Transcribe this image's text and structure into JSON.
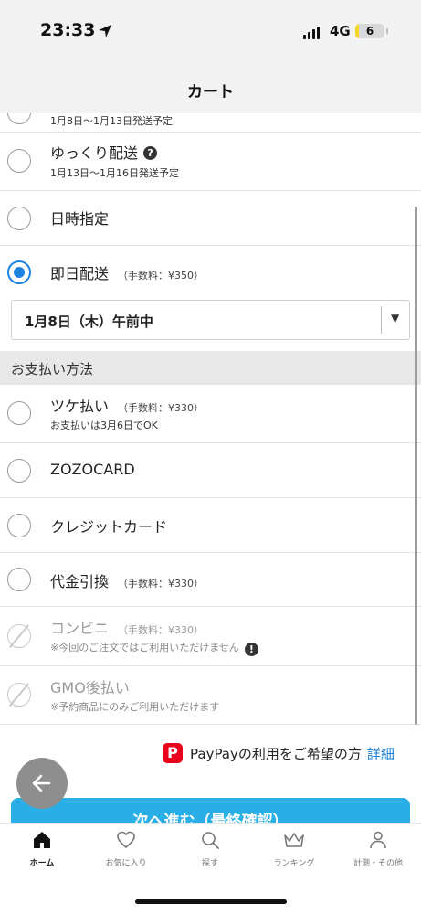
{
  "status_bar": {
    "time": "23:33",
    "network": "4G",
    "battery": "6",
    "battery_fraction": 0.06
  },
  "header": {
    "title": "カート"
  },
  "delivery_options": [
    {
      "title": "",
      "sub": "1月8日〜1月13日発送予定",
      "state": "default"
    },
    {
      "title": "ゆっくり配送",
      "sub": "1月13日〜1月16日発送予定",
      "state": "default",
      "help_icon": "?"
    },
    {
      "title": "日時指定",
      "state": "default"
    },
    {
      "title": "即日配送",
      "fee": "（手数料：¥350）",
      "state": "selected"
    }
  ],
  "date_select": {
    "value": "1月8日（木）午前中",
    "arrow": "▼"
  },
  "payment": {
    "section_title": "お支払い方法",
    "options": [
      {
        "title": "ツケ払い",
        "fee": "（手数料：¥330）",
        "sub": "お支払いは3月6日でOK",
        "state": "default"
      },
      {
        "title": "ZOZOCARD",
        "state": "default"
      },
      {
        "title": "クレジットカード",
        "state": "default"
      },
      {
        "title": "代金引換",
        "fee": "（手数料：¥330）",
        "state": "default"
      },
      {
        "title": "コンビニ",
        "fee": "（手数料：¥330）",
        "sub": "※今回のご注文ではご利用いただけません",
        "state": "disabled",
        "alert_icon": "!"
      },
      {
        "title": "GMO後払い",
        "sub": "※予約商品にのみご利用いただけます",
        "state": "disabled"
      }
    ]
  },
  "paypay": {
    "icon_letter": "P",
    "text": "PayPayの利用をご希望の方",
    "link": "詳細"
  },
  "next_button": {
    "label": "次へ進む（最終確認）"
  },
  "tab_bar": {
    "items": [
      {
        "label": "ホーム",
        "icon": "home-icon",
        "active": true
      },
      {
        "label": "お気に入り",
        "icon": "heart-icon",
        "active": false
      },
      {
        "label": "探す",
        "icon": "search-icon",
        "active": false
      },
      {
        "label": "ランキング",
        "icon": "crown-icon",
        "active": false
      },
      {
        "label": "計測・その他",
        "icon": "person-icon",
        "active": false
      }
    ]
  },
  "colors": {
    "accent": "#1b82e0",
    "button": "#29aee6",
    "paypay": "#e8001c",
    "link": "#1a7fd1",
    "battery": "#f3d526"
  }
}
